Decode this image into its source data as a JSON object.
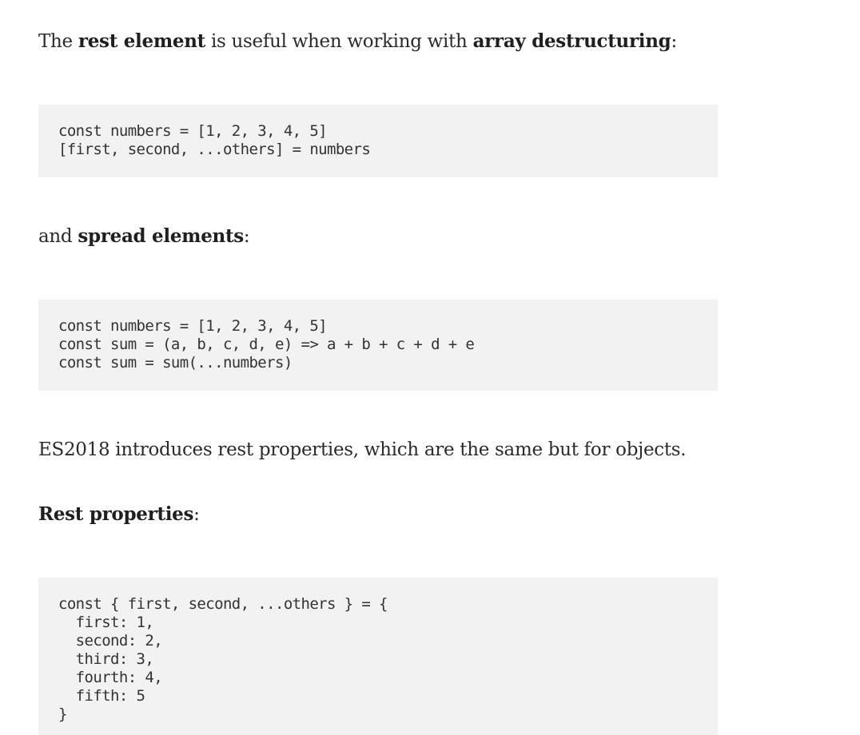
{
  "paragraphs": {
    "p1": {
      "before": "The ",
      "strong1": "rest element",
      "middle": " is useful when working with ",
      "strong2": "array destructuring",
      "after": ":"
    },
    "p2": {
      "before": "and ",
      "strong1": "spread elements",
      "after": ":"
    },
    "p3": {
      "text": "ES2018 introduces rest properties, which are the same but for objects."
    },
    "p4": {
      "strong1": "Rest properties",
      "after": ":"
    }
  },
  "code_blocks": {
    "array_destructuring": "const numbers = [1, 2, 3, 4, 5]\n[first, second, ...others] = numbers",
    "spread_elements": "const numbers = [1, 2, 3, 4, 5]\nconst sum = (a, b, c, d, e) => a + b + c + d + e\nconst sum = sum(...numbers)",
    "rest_properties": "const { first, second, ...others } = {\n  first: 1,\n  second: 2,\n  third: 3,\n  fourth: 4,\n  fifth: 5\n}"
  }
}
